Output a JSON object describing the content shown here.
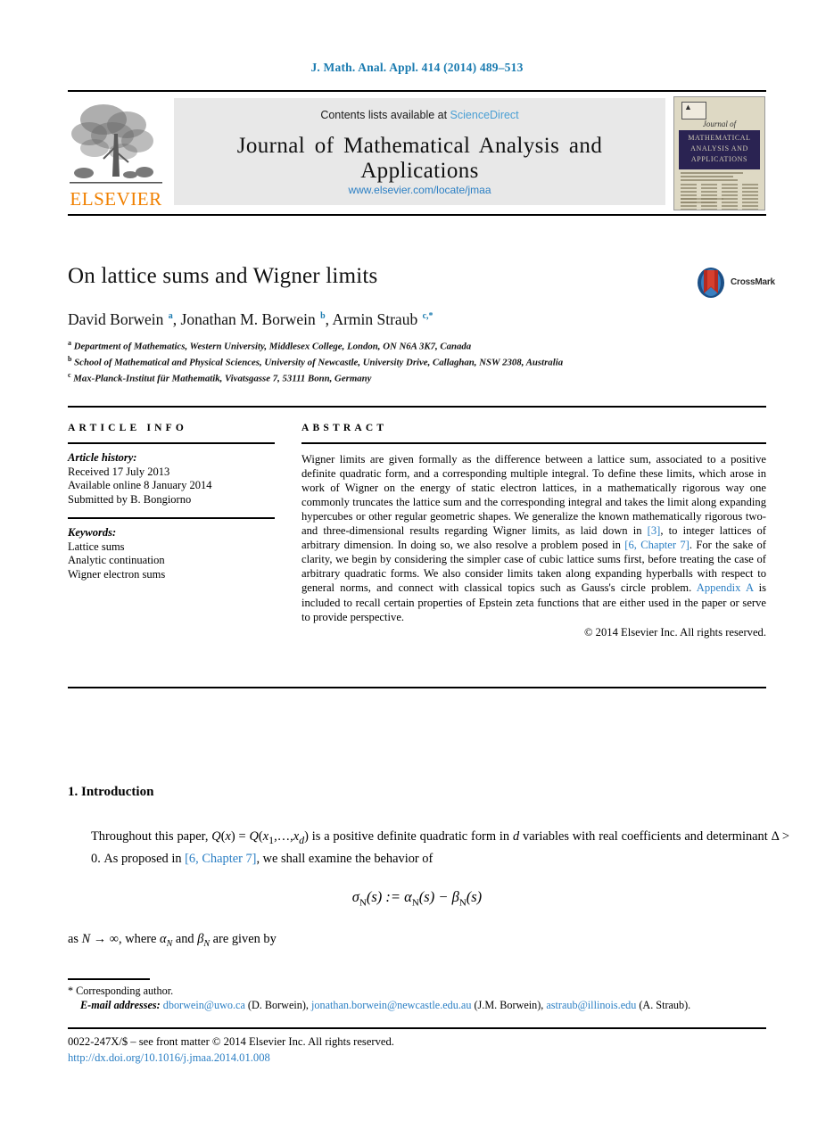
{
  "running_head": "J. Math. Anal. Appl. 414 (2014) 489–513",
  "masthead": {
    "contents_prefix": "Contents lists available at ",
    "sciencedirect": "ScienceDirect",
    "journal_title": "Journal of Mathematical Analysis and Applications",
    "journal_url": "www.elsevier.com/locate/jmaa",
    "publisher_wordmark": "ELSEVIER",
    "cover": {
      "journal_of": "Journal of",
      "band_line1": "MATHEMATICAL",
      "band_line2": "ANALYSIS AND",
      "band_line3": "APPLICATIONS"
    }
  },
  "article": {
    "title": "On lattice sums and Wigner limits",
    "crossmark_label": "CrossMark",
    "authors_html": "David Borwein <sup>a</sup>, Jonathan M. Borwein <sup>b</sup>, Armin Straub <sup>c,<span class=\"star\">*</span></sup>",
    "affiliations": [
      {
        "marker": "a",
        "text": "Department of Mathematics, Western University, Middlesex College, London, ON N6A 3K7, Canada"
      },
      {
        "marker": "b",
        "text": "School of Mathematical and Physical Sciences, University of Newcastle, University Drive, Callaghan, NSW 2308, Australia"
      },
      {
        "marker": "c",
        "text": "Max-Planck-Institut für Mathematik, Vivatsgasse 7, 53111 Bonn, Germany"
      }
    ]
  },
  "info": {
    "heading": "ARTICLE INFO",
    "history_label": "Article history:",
    "history": [
      "Received 17 July 2013",
      "Available online 8 January 2014",
      "Submitted by B. Bongiorno"
    ],
    "keywords_label": "Keywords:",
    "keywords": [
      "Lattice sums",
      "Analytic continuation",
      "Wigner electron sums"
    ]
  },
  "abstract": {
    "heading": "ABSTRACT",
    "text_html": "Wigner limits are given formally as the difference between a lattice sum, associated to a positive definite quadratic form, and a corresponding multiple integral. To define these limits, which arose in work of Wigner on the energy of static electron lattices, in a mathematically rigorous way one commonly truncates the lattice sum and the corresponding integral and takes the limit along expanding hypercubes or other regular geometric shapes. We generalize the known mathematically rigorous two- and three-dimensional results regarding Wigner limits, as laid down in <span class=\"ref-link\">[3]</span>, to integer lattices of arbitrary dimension. In doing so, we also resolve a problem posed in <span class=\"ref-link\">[6, Chapter 7]</span>. For the sake of clarity, we begin by considering the simpler case of cubic lattice sums first, before treating the case of arbitrary quadratic forms. We also consider limits taken along expanding hyperballs with respect to general norms, and connect with classical topics such as Gauss's circle problem. <span class=\"ref-link\">Appendix A</span> is included to recall certain properties of Epstein zeta functions that are either used in the paper or serve to provide perspective.",
    "copyright": "© 2014 Elsevier Inc. All rights reserved."
  },
  "body": {
    "section_heading": "1. Introduction",
    "paragraph1_html": "Throughout this paper, <span class=\"mi\">Q</span>(<span class=\"mi\">x</span>) = <span class=\"mi\">Q</span>(<span class=\"mi\">x</span><sub>1</sub>,…,<span class=\"mi\">x</span><sub><span class=\"mi\">d</span></sub>) is a positive definite quadratic form in <span class=\"mi\">d</span> variables with real coefficients and determinant Δ &gt; 0. As proposed in <span class=\"ref-link\">[6, Chapter 7]</span>, we shall examine the behavior of",
    "equation_html": "σ<sub>N</sub>(s) := α<sub>N</sub>(s) − β<sub>N</sub>(s)",
    "paragraph2_html": "as <span class=\"mi\">N</span> → ∞, where <span class=\"mi\">α</span><sub><span class=\"mi\">N</span></sub> and <span class=\"mi\">β</span><sub><span class=\"mi\">N</span></sub> are given by"
  },
  "footnotes": {
    "corresponding": "* Corresponding author.",
    "email_label": "E-mail addresses:",
    "emails_html": "<span class=\"mail-link\">dborwein@uwo.ca</span> (D. Borwein), <span class=\"mail-link\">jonathan.borwein@newcastle.edu.au</span> (J.M. Borwein), <span class=\"mail-link\">astraub@illinois.edu</span> (A. Straub)."
  },
  "colophon": {
    "issn_line": "0022-247X/$ – see front matter © 2014 Elsevier Inc. All rights reserved.",
    "doi_url": "http://dx.doi.org/10.1016/j.jmaa.2014.01.008"
  },
  "colors": {
    "link_blue": "#2b7fc4",
    "running_head_blue": "#1a7bb0",
    "sciencedirect_blue": "#4a9fd4",
    "elsevier_orange": "#f08000",
    "cover_navy": "#2a2352",
    "cover_cream": "#ded9c4"
  }
}
